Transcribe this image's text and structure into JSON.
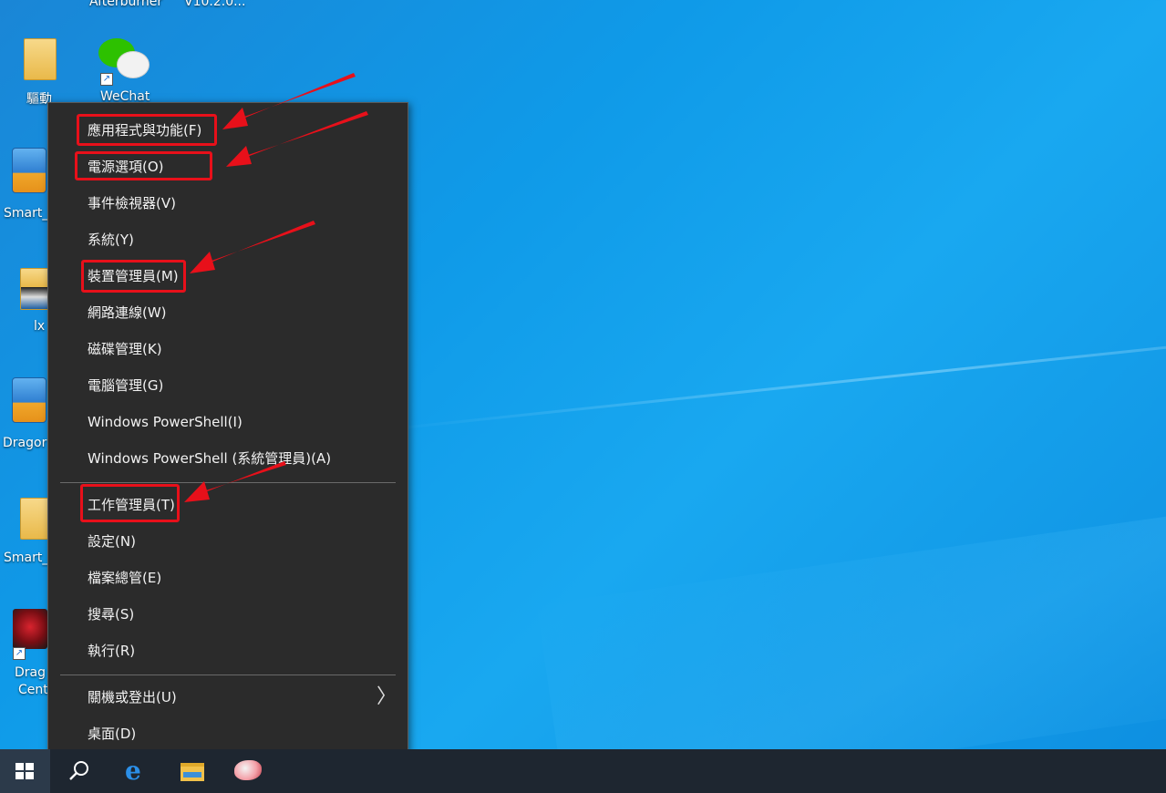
{
  "desktop": {
    "top_labels": [
      "Afterburner",
      "V10.2.0..."
    ],
    "icons": [
      {
        "label": "驅動",
        "icon": "folder-icon"
      },
      {
        "label": "WeChat",
        "icon": "wechat-icon"
      },
      {
        "label": "Smart_",
        "icon": "installer-icon"
      },
      {
        "label": "lx",
        "icon": "folder-icon"
      },
      {
        "label": "Dragor",
        "icon": "installer-icon"
      },
      {
        "label": "Smart_",
        "icon": "folder-icon"
      },
      {
        "label": "Drag",
        "label2": "Cent",
        "icon": "msi-dragon-icon"
      }
    ],
    "shortcut_glyph": "↗"
  },
  "menu": {
    "items": [
      {
        "label": "應用程式與功能(F)",
        "highlighted": true
      },
      {
        "label": "電源選項(O)",
        "highlighted": true
      },
      {
        "label": "事件檢視器(V)",
        "highlighted": false
      },
      {
        "label": "系統(Y)",
        "highlighted": false
      },
      {
        "label": "裝置管理員(M)",
        "highlighted": true
      },
      {
        "label": "網路連線(W)",
        "highlighted": false
      },
      {
        "label": "磁碟管理(K)",
        "highlighted": false
      },
      {
        "label": "電腦管理(G)",
        "highlighted": false
      },
      {
        "label": "Windows PowerShell(I)",
        "highlighted": false
      },
      {
        "label": "Windows PowerShell (系統管理員)(A)",
        "highlighted": false
      },
      {
        "label": "工作管理員(T)",
        "highlighted": true
      },
      {
        "label": "設定(N)",
        "highlighted": false
      },
      {
        "label": "檔案總管(E)",
        "highlighted": false
      },
      {
        "label": "搜尋(S)",
        "highlighted": false
      },
      {
        "label": "執行(R)",
        "highlighted": false
      },
      {
        "label": "關機或登出(U)",
        "highlighted": false,
        "submenu": true
      },
      {
        "label": "桌面(D)",
        "highlighted": false
      }
    ],
    "submenu_glyph": "〉"
  },
  "annotation": {
    "color": "#e8101a"
  },
  "taskbar": {
    "buttons": [
      {
        "name": "start",
        "icon": "windows-logo-icon"
      },
      {
        "name": "search",
        "icon": "search-icon"
      },
      {
        "name": "edge",
        "icon": "edge-browser-icon",
        "glyph": "e"
      },
      {
        "name": "file-explorer",
        "icon": "file-explorer-icon"
      },
      {
        "name": "app",
        "icon": "app-icon"
      }
    ]
  },
  "colors": {
    "menu_bg": "#2b2b2b",
    "menu_text": "#f2f2f2",
    "taskbar_bg": "#1e2630",
    "desktop_blue": "#0f9ae8",
    "highlight_red": "#e8101a"
  }
}
